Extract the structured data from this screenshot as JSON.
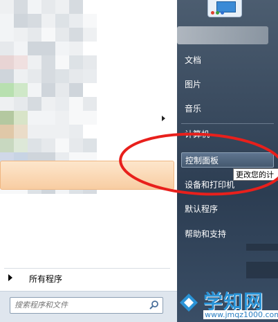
{
  "left_pane": {
    "all_programs": "所有程序",
    "search_placeholder": "搜索程序和文件"
  },
  "right_pane": {
    "items": [
      {
        "label": "文档"
      },
      {
        "label": "图片"
      },
      {
        "label": "音乐"
      },
      {
        "label": "计算机"
      },
      {
        "label": "控制面板"
      },
      {
        "label": "设备和打印机"
      },
      {
        "label": "默认程序"
      },
      {
        "label": "帮助和支持"
      }
    ]
  },
  "tooltip": "更改您的计",
  "annotation_color": "#e8201c",
  "highlight_color": "#f8cda2",
  "watermark": {
    "title": "学知网",
    "url": "www.jmqz1000.com"
  }
}
